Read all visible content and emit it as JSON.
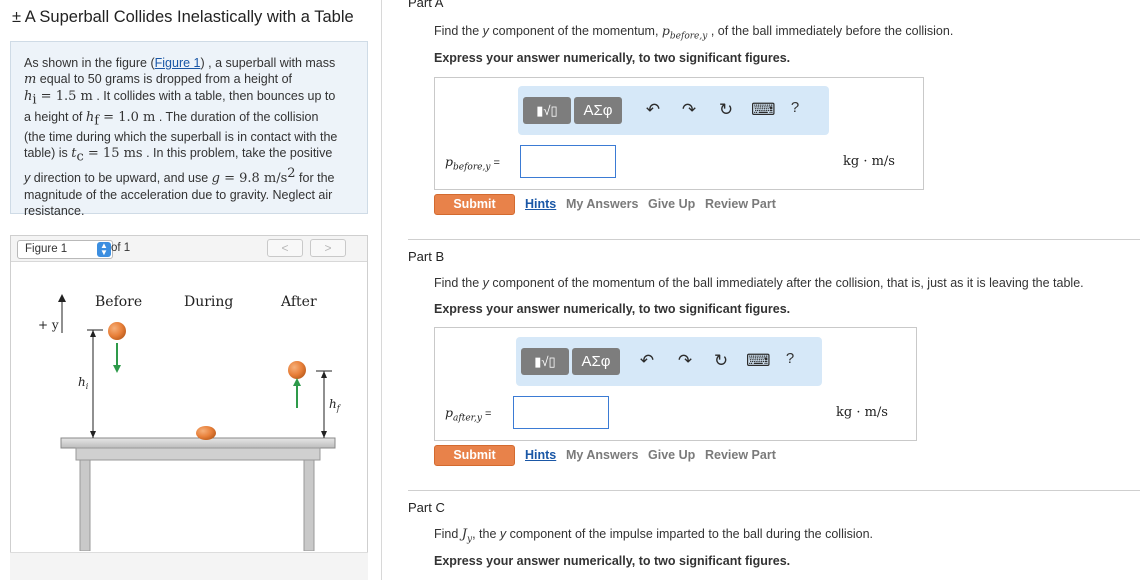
{
  "problem": {
    "title": "± A Superball Collides Inelastically with a Table",
    "text_1": "As shown in the figure (",
    "figure_link": "Figure 1",
    "text_2": ") , a superball with mass",
    "m_var": "m",
    "text_3": " equal to 50 grams is dropped from a height of",
    "hi_label": "h",
    "hi_sub": "i",
    "hi_eq": " = 1.5 m",
    "text_4": " . It collides with a table, then bounces up to",
    "text_5": "a height of ",
    "hf_label": "h",
    "hf_sub": "f",
    "hf_eq": " = 1.0 m",
    "text_6": " . The duration of the collision",
    "text_7": "(the time during which the superball is in contact with the",
    "text_8": "table) is ",
    "tc_label": "t",
    "tc_sub": "c",
    "tc_eq": " = 15 ms",
    "text_9": " . In this problem, take the positive",
    "text_10a": "y",
    "text_10b": " direction to be upward, and use ",
    "g_label": "g",
    "g_eq": " = 9.8 m/s",
    "g_sup": "2",
    "text_10c": " for the",
    "text_11": "magnitude of the acceleration due to gravity. Neglect air",
    "text_12": "resistance."
  },
  "figure_panel": {
    "select_value": "Figure 1",
    "of_label": "of 1",
    "prev_label": "<",
    "next_label": ">",
    "labels": {
      "before": "Before",
      "during": "During",
      "after": "After",
      "plus_y": "+ y",
      "hi": "h",
      "hi_sub": "i",
      "hf": "h",
      "hf_sub": "f"
    }
  },
  "header_part": "Part A",
  "parts": {
    "a": {
      "question_pre": "Find the ",
      "question_y": "y",
      "question_mid": " component of the momentum, ",
      "question_var": "p",
      "question_var_sub": "before,y",
      "question_post": " , of the ball immediately before the collision.",
      "instruction": "Express your answer numerically, to two significant figures.",
      "var_label": "p",
      "var_sub": "before,y",
      "var_eq": " =",
      "units": "kg · m/s",
      "input_value": ""
    },
    "b": {
      "label": "Part B",
      "question_pre": "Find the ",
      "question_y": "y",
      "question_post": " component of the momentum of the ball immediately after the collision, that is, just as it is leaving the table.",
      "instruction": "Express your answer numerically, to two significant figures.",
      "var_label": "p",
      "var_sub": "after,y",
      "var_eq": " =",
      "units": "kg · m/s",
      "input_value": ""
    },
    "c": {
      "label": "Part C",
      "question_pre": "Find ",
      "question_var": "J",
      "question_var_sub": "y",
      "question_mid": ", the ",
      "question_y": "y",
      "question_post": " component of the impulse imparted to the ball during the collision.",
      "instruction": "Express your answer numerically, to two significant figures."
    }
  },
  "toolbar": {
    "templates_label": "▮√▯",
    "symbols_label": "ΑΣφ",
    "undo_icon": "↶",
    "redo_icon": "↷",
    "reset_icon": "↻",
    "keyboard_icon": "⌨",
    "help_label": "?"
  },
  "actions": {
    "submit": "Submit",
    "hints": "Hints",
    "my_answers": "My Answers",
    "give_up": "Give Up",
    "review_part": "Review Part"
  },
  "colors": {
    "submit_bg": "#e8824a",
    "toolbar_bg": "#d6e8f8",
    "input_border": "#3b7bd4",
    "problem_bg": "#edf3f9",
    "ball": "#e8803a",
    "arrow_green": "#2e9a4a"
  }
}
